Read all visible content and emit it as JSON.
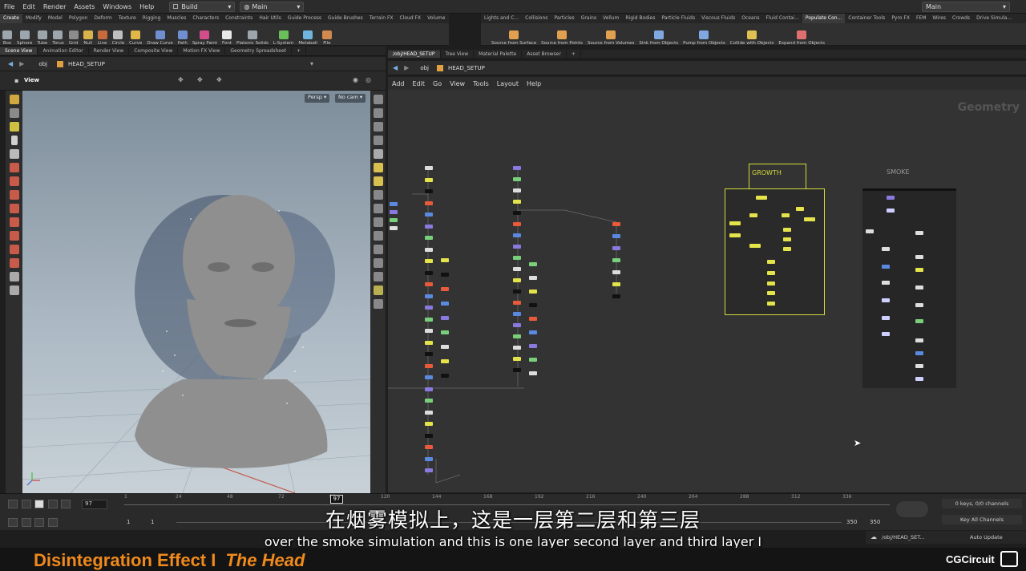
{
  "menubar": {
    "items": [
      "File",
      "Edit",
      "Render",
      "Assets",
      "Windows",
      "Help"
    ],
    "desktop": "Build",
    "context": "Main",
    "right_desktop": "Main"
  },
  "shelf_left": {
    "tabs": [
      "Create",
      "Modify",
      "Model",
      "Polygon",
      "Deform",
      "Texture",
      "Rigging",
      "Muscles",
      "Characters",
      "Constraints",
      "Hair Utils",
      "Guide Process",
      "Guide Brushes",
      "Terrain FX",
      "Cloud FX",
      "Volume"
    ],
    "tools": [
      {
        "label": "Box",
        "color": "#9ea6ad"
      },
      {
        "label": "Sphere",
        "color": "#9ea6ad"
      },
      {
        "label": "Tube",
        "color": "#9ea6ad"
      },
      {
        "label": "Torus",
        "color": "#9ea6ad"
      },
      {
        "label": "Grid",
        "color": "#8c8c8c"
      },
      {
        "label": "Null",
        "color": "#d8b24a"
      },
      {
        "label": "Line",
        "color": "#c76a3c"
      },
      {
        "label": "Circle",
        "color": "#bfbfbf"
      },
      {
        "label": "Curve",
        "color": "#e0b84a"
      },
      {
        "label": "Draw Curve",
        "color": "#6f8fd0"
      },
      {
        "label": "Path",
        "color": "#6f8fd0"
      },
      {
        "label": "Spray Paint",
        "color": "#d04f8a"
      },
      {
        "label": "Font",
        "color": "#e8e8e8"
      },
      {
        "label": "Platonic Solids",
        "color": "#9ea6ad"
      },
      {
        "label": "L-System",
        "color": "#6abf5b"
      },
      {
        "label": "Metaball",
        "color": "#6fb5e0"
      },
      {
        "label": "File",
        "color": "#d08a4f"
      }
    ]
  },
  "shelf_right": {
    "tabs": [
      "Lights and C...",
      "Collisions",
      "Particles",
      "Grains",
      "Vellum",
      "Rigid Bodies",
      "Particle Fluids",
      "Viscous Fluids",
      "Oceans",
      "Fluid Contai...",
      "Populate Con...",
      "Container Tools",
      "Pyro FX",
      "FEM",
      "Wires",
      "Crowds",
      "Drive Simula..."
    ],
    "active_tab": "Populate Con...",
    "tools": [
      {
        "label": "Source from Surface",
        "color": "#e0a050"
      },
      {
        "label": "Source from Points",
        "color": "#e0a050"
      },
      {
        "label": "Source from Volumes",
        "color": "#e0a050"
      },
      {
        "label": "Sink from Objects",
        "color": "#7fa8e0"
      },
      {
        "label": "Pump from Objects",
        "color": "#7fa8e0"
      },
      {
        "label": "Collide with Objects",
        "color": "#e0c050"
      },
      {
        "label": "Expand from Objects",
        "color": "#e07070"
      }
    ]
  },
  "left_pane": {
    "tabs": [
      "Scene View",
      "Animation Editor",
      "Render View",
      "Composite View",
      "Motion FX View",
      "Geometry Spreadsheet"
    ],
    "path": [
      "obj",
      "HEAD_SETUP"
    ],
    "view_label": "View",
    "camera_persp": "Persp",
    "camera_cam": "No cam"
  },
  "right_pane": {
    "tabs": [
      "/obj/HEAD_SETUP",
      "Tree View",
      "Material Palette",
      "Asset Browser"
    ],
    "path": [
      "obj",
      "HEAD_SETUP"
    ],
    "menu": [
      "Add",
      "Edit",
      "Go",
      "View",
      "Tools",
      "Layout",
      "Help"
    ],
    "context_watermark": "Geometry",
    "boxes": [
      {
        "title": "GROWTH",
        "color": "#d4db3a"
      },
      {
        "title": "SMOKE",
        "color": "#9a9a9a"
      }
    ]
  },
  "timeline": {
    "current_frame": "97",
    "frame_field": "97",
    "start_frame": "1",
    "start_frame2": "1",
    "end_frame": "350",
    "end_frame2": "350",
    "ticks": [
      "1",
      "24",
      "48",
      "72",
      "96",
      "120",
      "144",
      "168",
      "192",
      "216",
      "240",
      "264",
      "288",
      "312",
      "336"
    ],
    "keys_info": "0 keys, 0/0 channels",
    "key_mode": "Key All Channels",
    "obj_path": "/obj/HEAD_SET...",
    "auto_update": "Auto Update"
  },
  "subtitles": {
    "cn": "在烟雾模拟上，这是一层第二层和第三层",
    "en": "over the smoke simulation and this is one layer second layer and third layer I"
  },
  "branding": {
    "course_title": "Disintegration Effect I",
    "course_sub": "The Head",
    "brand": "CGCircuit",
    "accent": "#f08a1c"
  }
}
